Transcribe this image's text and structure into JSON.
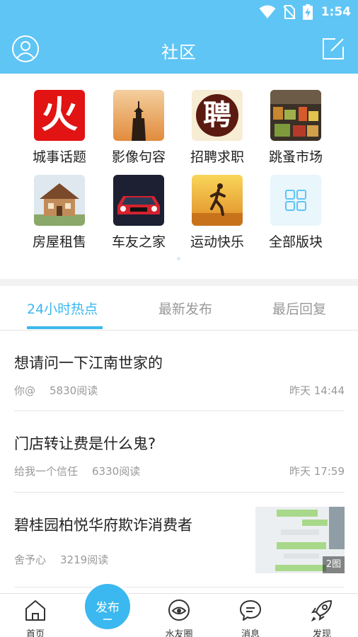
{
  "status": {
    "time": "1:54"
  },
  "header": {
    "title": "社区"
  },
  "categories": [
    {
      "label": "城事话题",
      "glyph": "火",
      "icon": "fire-icon"
    },
    {
      "label": "影像句容",
      "icon": "pagoda-photo"
    },
    {
      "label": "招聘求职",
      "glyph": "聘",
      "icon": "recruit-icon"
    },
    {
      "label": "跳蚤市场",
      "icon": "market-photo"
    },
    {
      "label": "房屋租售",
      "icon": "house-photo"
    },
    {
      "label": "车友之家",
      "icon": "car-photo"
    },
    {
      "label": "运动快乐",
      "icon": "runner-photo"
    },
    {
      "label": "全部版块",
      "icon": "grid-icon"
    }
  ],
  "tabs": [
    {
      "label": "24小时热点",
      "active": true
    },
    {
      "label": "最新发布",
      "active": false
    },
    {
      "label": "最后回复",
      "active": false
    }
  ],
  "posts": [
    {
      "title": "想请问一下江南世家的",
      "author": "你@",
      "reads": "5830阅读",
      "time": "昨天 14:44"
    },
    {
      "title": "门店转让费是什么鬼?",
      "author": "给我一个信任",
      "reads": "6330阅读",
      "time": "昨天 17:59"
    },
    {
      "title": "碧桂园柏悦华府欺诈消费者",
      "author": "舍予心",
      "reads": "3219阅读",
      "image_badge": "2图"
    }
  ],
  "fab": {
    "label": "发布"
  },
  "nav": [
    {
      "label": "首页",
      "icon": "home-icon"
    },
    {
      "label": "水友圈",
      "icon": "circle-eye-icon"
    },
    {
      "label": "消息",
      "icon": "message-icon"
    },
    {
      "label": "发现",
      "icon": "rocket-icon"
    }
  ],
  "colors": {
    "primary": "#5ec5f5",
    "accent": "#3ab8ef"
  }
}
